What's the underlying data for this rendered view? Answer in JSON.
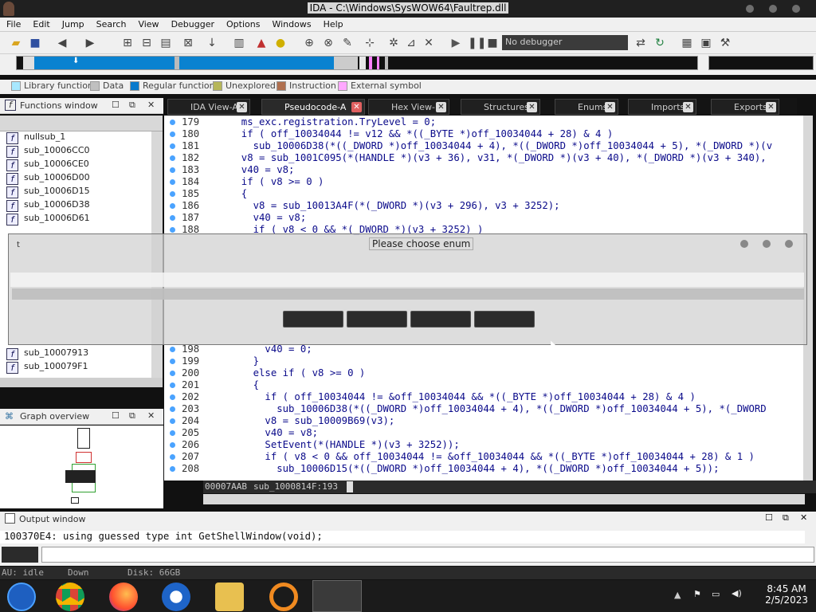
{
  "window": {
    "title": "IDA - C:\\Windows\\SysWOW64\\Faultrep.dll"
  },
  "menu": [
    "File",
    "Edit",
    "Jump",
    "Search",
    "View",
    "Debugger",
    "Options",
    "Windows",
    "Help"
  ],
  "toolbar": {
    "debugger_select": "No debugger"
  },
  "legend": [
    {
      "label": "Library function",
      "color": "#a8e8ff"
    },
    {
      "label": "Data",
      "color": "#c0c0c0"
    },
    {
      "label": "Regular function",
      "color": "#0a7acc"
    },
    {
      "label": "Unexplored",
      "color": "#b6b65a"
    },
    {
      "label": "Instruction",
      "color": "#b07050"
    },
    {
      "label": "External symbol",
      "color": "#ffa8ff"
    }
  ],
  "functions_panel": {
    "title": "Functions window",
    "items": [
      "nullsub_1",
      "sub_10006CC0",
      "sub_10006CE0",
      "sub_10006D00",
      "sub_10006D15",
      "sub_10006D38",
      "sub_10006D61"
    ],
    "items_bottom": [
      "sub_10007913",
      "sub_100079F1"
    ]
  },
  "graph_panel": {
    "title": "Graph overview"
  },
  "tabs": [
    {
      "label": "IDA View-A",
      "active": false
    },
    {
      "label": "Pseudocode-A",
      "active": true
    },
    {
      "label": "Hex View-1",
      "active": false
    },
    {
      "label": "Structures",
      "active": false
    },
    {
      "label": "Enums",
      "active": false
    },
    {
      "label": "Imports",
      "active": false
    },
    {
      "label": "Exports",
      "active": false
    }
  ],
  "code_lines": [
    {
      "n": "179",
      "text": "  ms_exc.registration.TryLevel = 0;"
    },
    {
      "n": "180",
      "text": "  if ( off_10034044 != v12 && *((_BYTE *)off_10034044 + 28) & 4 )"
    },
    {
      "n": "181",
      "text": "    sub_10006D38(*((_DWORD *)off_10034044 + 4), *((_DWORD *)off_10034044 + 5), *(_DWORD *)(v"
    },
    {
      "n": "182",
      "text": "  v8 = sub_1001C095(*(HANDLE *)(v3 + 36), v31, *(_DWORD *)(v3 + 40), *(_DWORD *)(v3 + 340),"
    },
    {
      "n": "183",
      "text": "  v40 = v8;"
    },
    {
      "n": "184",
      "text": "  if ( v8 >= 0 )"
    },
    {
      "n": "185",
      "text": "  {"
    },
    {
      "n": "186",
      "text": "    v8 = sub_10013A4F(*(_DWORD *)(v3 + 296), v3 + 3252);"
    },
    {
      "n": "187",
      "text": "    v40 = v8;"
    },
    {
      "n": "188",
      "text": "    if ( v8 < 0 && *(_DWORD *)(v3 + 3252) )"
    },
    {
      "n": "198",
      "text": "      v40 = 0;"
    },
    {
      "n": "199",
      "text": "    }"
    },
    {
      "n": "200",
      "text": "    else if ( v8 >= 0 )"
    },
    {
      "n": "201",
      "text": "    {"
    },
    {
      "n": "202",
      "text": "      if ( off_10034044 != &off_10034044 && *((_BYTE *)off_10034044 + 28) & 4 )"
    },
    {
      "n": "203",
      "text": "        sub_10006D38(*((_DWORD *)off_10034044 + 4), *((_DWORD *)off_10034044 + 5), *(_DWORD"
    },
    {
      "n": "204",
      "text": "      v8 = sub_10009B69(v3);"
    },
    {
      "n": "205",
      "text": "      v40 = v8;"
    },
    {
      "n": "206",
      "text": "      SetEvent(*(HANDLE *)(v3 + 3252));"
    },
    {
      "n": "207",
      "text": "      if ( v8 < 0 && off_10034044 != &off_10034044 && *((_BYTE *)off_10034044 + 28) & 1 )"
    },
    {
      "n": "208",
      "text": "        sub_10006D15(*((_DWORD *)off_10034044 + 4), *((_DWORD *)off_10034044 + 5));"
    }
  ],
  "dialog": {
    "title": "Please choose enum"
  },
  "code_status": {
    "addr": "00007AAB",
    "func": "sub_1000814F:193"
  },
  "output": {
    "title": "Output window",
    "line": "100370E4: using guessed type int GetShellWindow(void);"
  },
  "bottom_status": {
    "au": "AU:  idle",
    "dir": "Down",
    "disk": "Disk: 66GB"
  },
  "clock": {
    "time": "8:45 AM",
    "date": "2/5/2023"
  }
}
